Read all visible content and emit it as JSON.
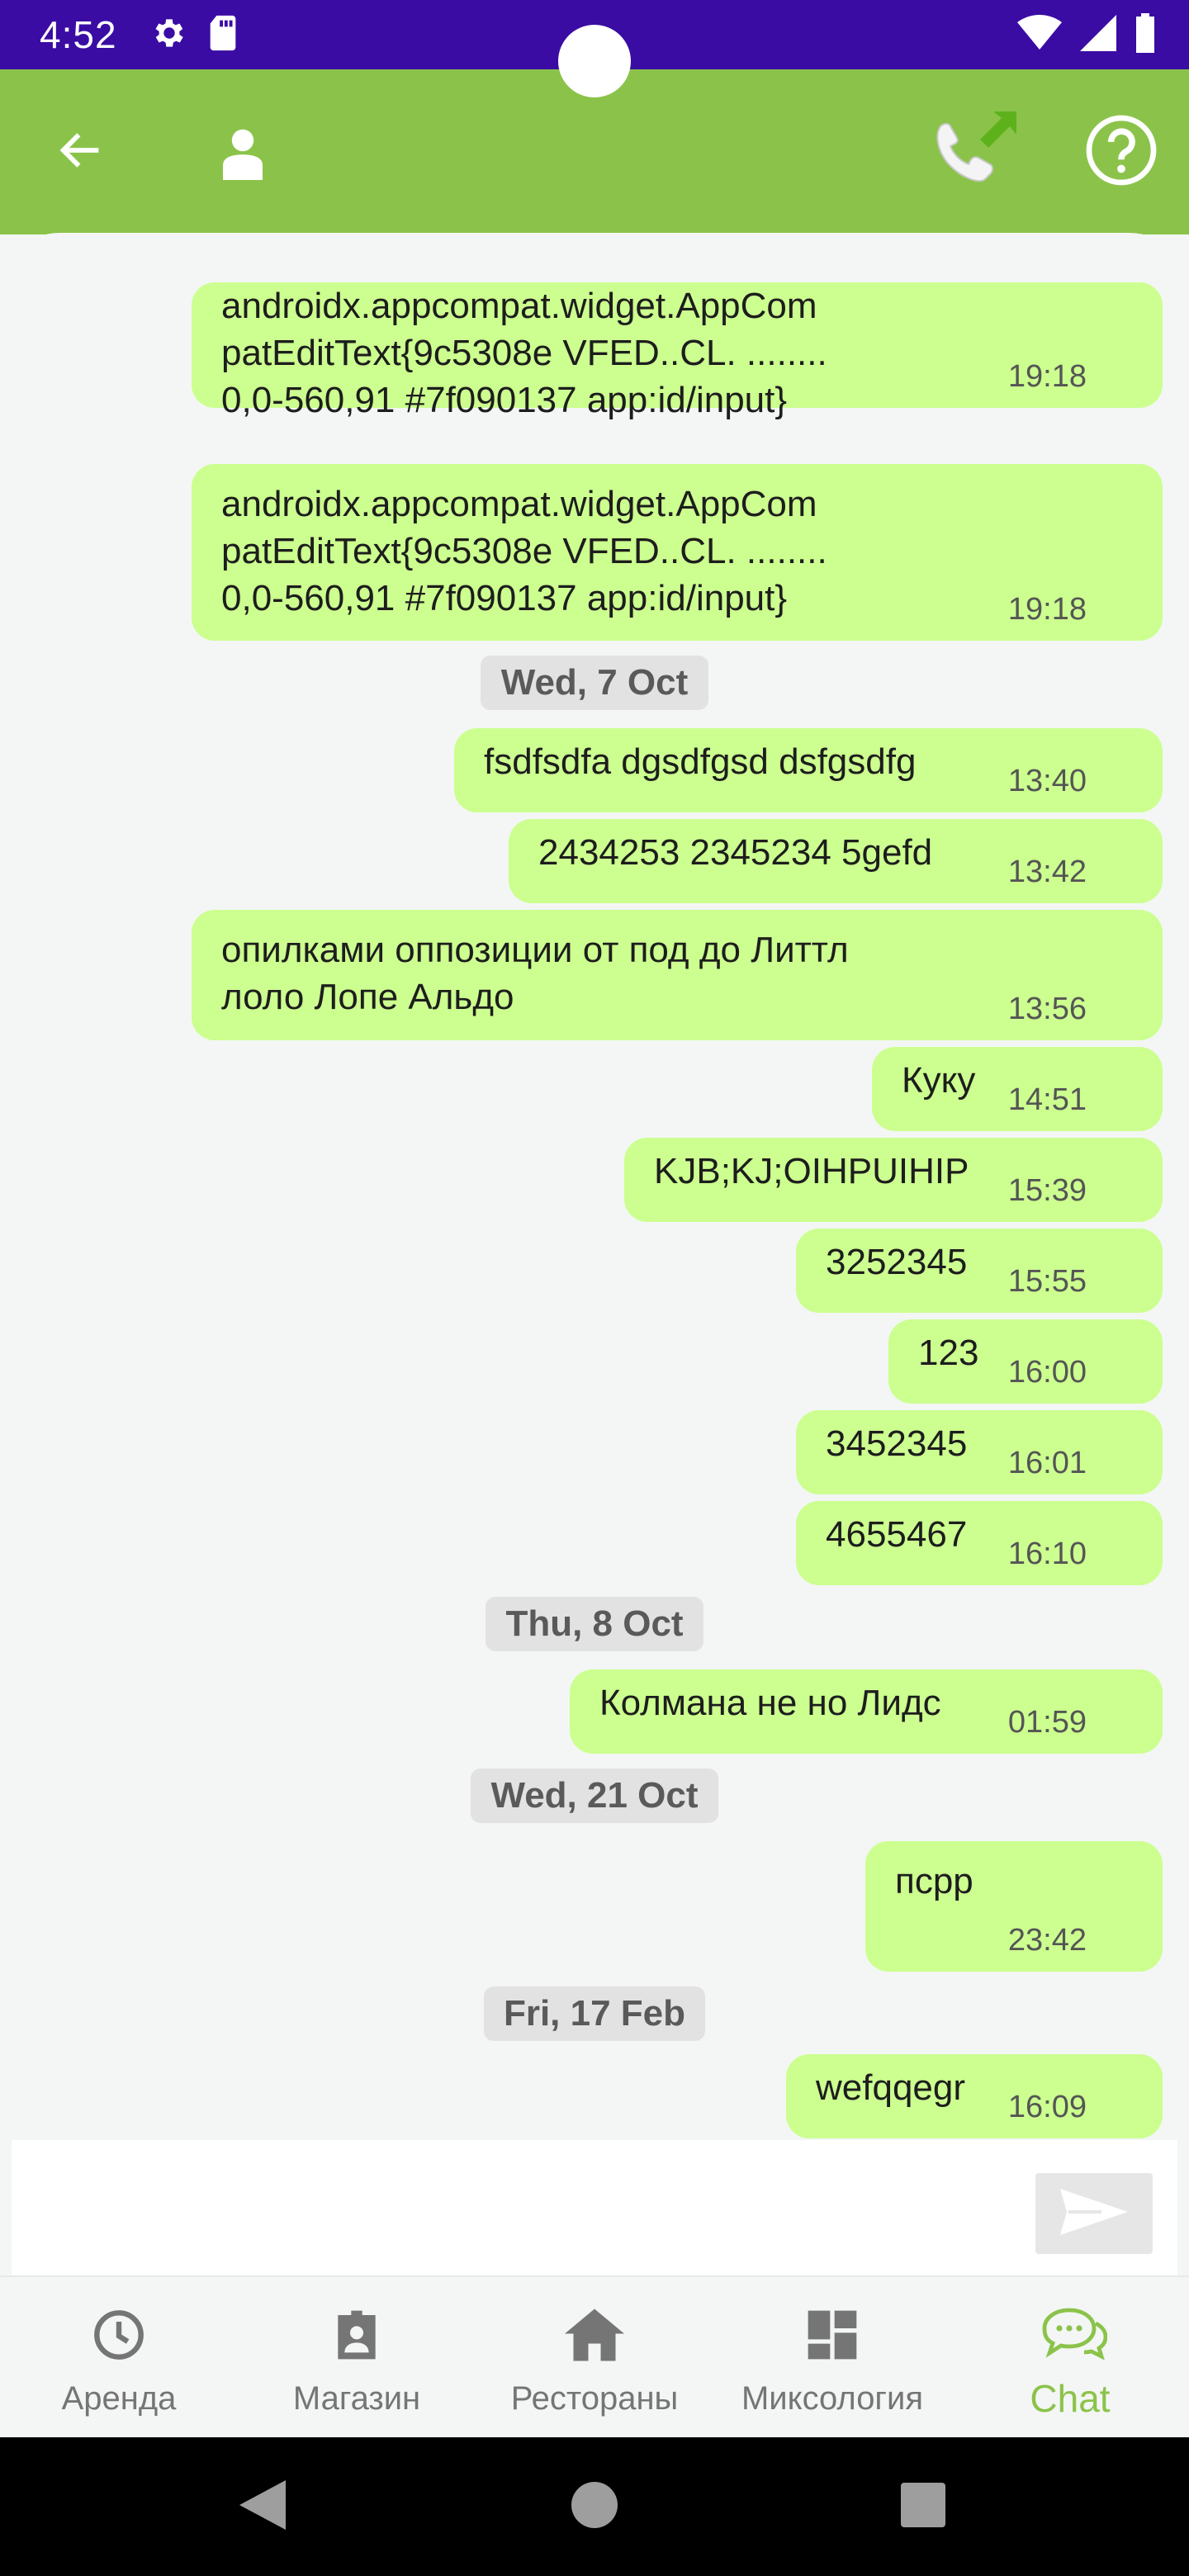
{
  "status_bar": {
    "time": "4:52",
    "icons": [
      "gear-icon",
      "sd-card-icon",
      "wifi-icon",
      "signal-icon",
      "battery-icon"
    ]
  },
  "app_bar": {
    "back_icon": "arrow-left-icon",
    "avatar_icon": "user-icon",
    "call_icon": "phone-forward-icon",
    "help_icon": "question-circle-icon",
    "bar_color": "#8bc34a"
  },
  "messages": [
    {
      "type": "bubble",
      "text": "androidx.appcompat.widget.AppCom\npatEditText{9c5308e VFED..CL. ........\n0,0-560,91 #7f090137 app:id/input}",
      "time": "19:18"
    },
    {
      "type": "bubble",
      "text": "androidx.appcompat.widget.AppCom\npatEditText{9c5308e VFED..CL. ........\n0,0-560,91 #7f090137 app:id/input}",
      "time": "19:18"
    },
    {
      "type": "date",
      "text": "Wed, 7 Oct"
    },
    {
      "type": "bubble",
      "text": "fsdfsdfa dgsdfgsd dsfgsdfg",
      "time": "13:40"
    },
    {
      "type": "bubble",
      "text": "2434253 2345234 5gefd",
      "time": "13:42"
    },
    {
      "type": "bubble",
      "text": "опилками оппозиции от под до Литтл\nлоло Лопе Альдо",
      "time": "13:56"
    },
    {
      "type": "bubble",
      "text": "Куку",
      "time": "14:51"
    },
    {
      "type": "bubble",
      "text": "KJB;KJ;OIHPUIHIP",
      "time": "15:39"
    },
    {
      "type": "bubble",
      "text": "3252345",
      "time": "15:55"
    },
    {
      "type": "bubble",
      "text": "123",
      "time": "16:00"
    },
    {
      "type": "bubble",
      "text": "3452345",
      "time": "16:01"
    },
    {
      "type": "bubble",
      "text": "4655467",
      "time": "16:10"
    },
    {
      "type": "date",
      "text": "Thu, 8 Oct"
    },
    {
      "type": "bubble",
      "text": "Колмана не но Лидс",
      "time": "01:59"
    },
    {
      "type": "date",
      "text": "Wed, 21 Oct"
    },
    {
      "type": "bubble",
      "text": "пcpp",
      "time": "23:42"
    },
    {
      "type": "date",
      "text": "Fri, 17 Feb"
    },
    {
      "type": "bubble",
      "text": "wefqqegr",
      "time": "16:09"
    }
  ],
  "composer": {
    "input_value": "",
    "input_placeholder": "",
    "send_icon": "send-icon"
  },
  "bottom_nav": {
    "items": [
      {
        "label": "Аренда",
        "icon": "clock-icon",
        "active": false
      },
      {
        "label": "Магазин",
        "icon": "badge-icon",
        "active": false
      },
      {
        "label": "Рестораны",
        "icon": "home-icon",
        "active": false
      },
      {
        "label": "Миксология",
        "icon": "dashboard-icon",
        "active": false
      },
      {
        "label": "Chat",
        "icon": "chat-bubbles-icon",
        "active": true
      }
    ],
    "active_color": "#8bc34a"
  },
  "system_nav": {
    "icons": [
      "back-triangle-icon",
      "home-circle-icon",
      "recents-square-icon"
    ]
  },
  "colors": {
    "status_bar": "#3a0ca3",
    "bubble": "#ccff8f",
    "date_chip": "#e2e2e2"
  }
}
